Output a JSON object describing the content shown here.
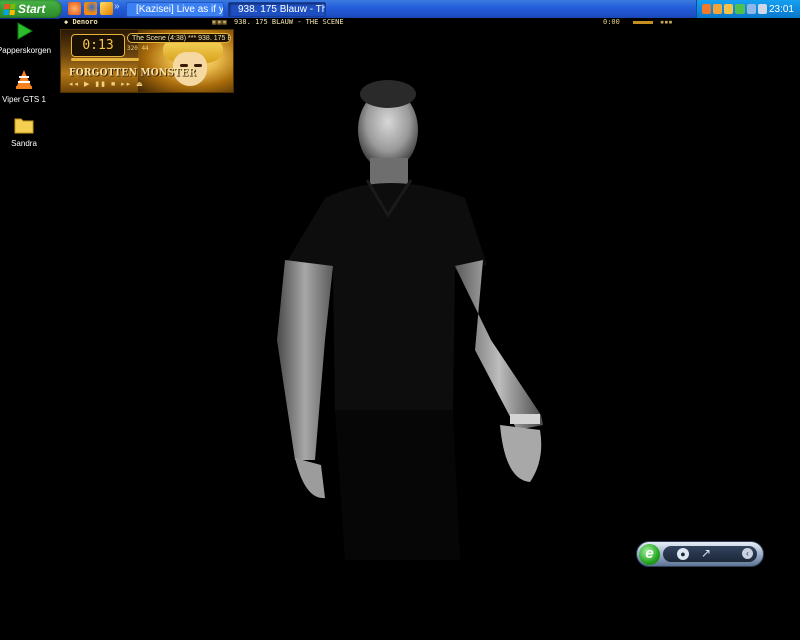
{
  "taskbar": {
    "start_label": "Start",
    "quick_launch": [
      "avast-icon",
      "firefox-icon",
      "media-player-icon"
    ],
    "tasks": [
      {
        "label": "[Kazisei] Live as if yo...",
        "icon": "messenger-icon",
        "active": false
      },
      {
        "label": "938. 175 Blauw - The...",
        "icon": "winamp-icon",
        "active": true
      }
    ],
    "tray_icons": [
      "avast-tray-icon",
      "app-tray-icon",
      "winamp-tray-icon",
      "messenger-tray-icon",
      "network-tray-icon",
      "volume-tray-icon"
    ],
    "clock": "23:01"
  },
  "winamp": {
    "title": "Denoro",
    "track": "938. 175 BLAUW - THE SCENE",
    "time": "0:00",
    "skin": {
      "time": "0:13",
      "track_scroll": "The Scene (4:38) *** 938. 175 B",
      "kbps": "320   44",
      "logo_text": "FORGOTTEN MONSTER"
    }
  },
  "desktop_icons": [
    {
      "label": "Papperskorgen",
      "icon": "recycle-bin-icon"
    },
    {
      "label": "Viper GTS 1",
      "icon": "vlc-cone-icon"
    },
    {
      "label": "Sandra",
      "icon": "folder-icon"
    }
  ],
  "ie_widget": {
    "logo": "e"
  }
}
